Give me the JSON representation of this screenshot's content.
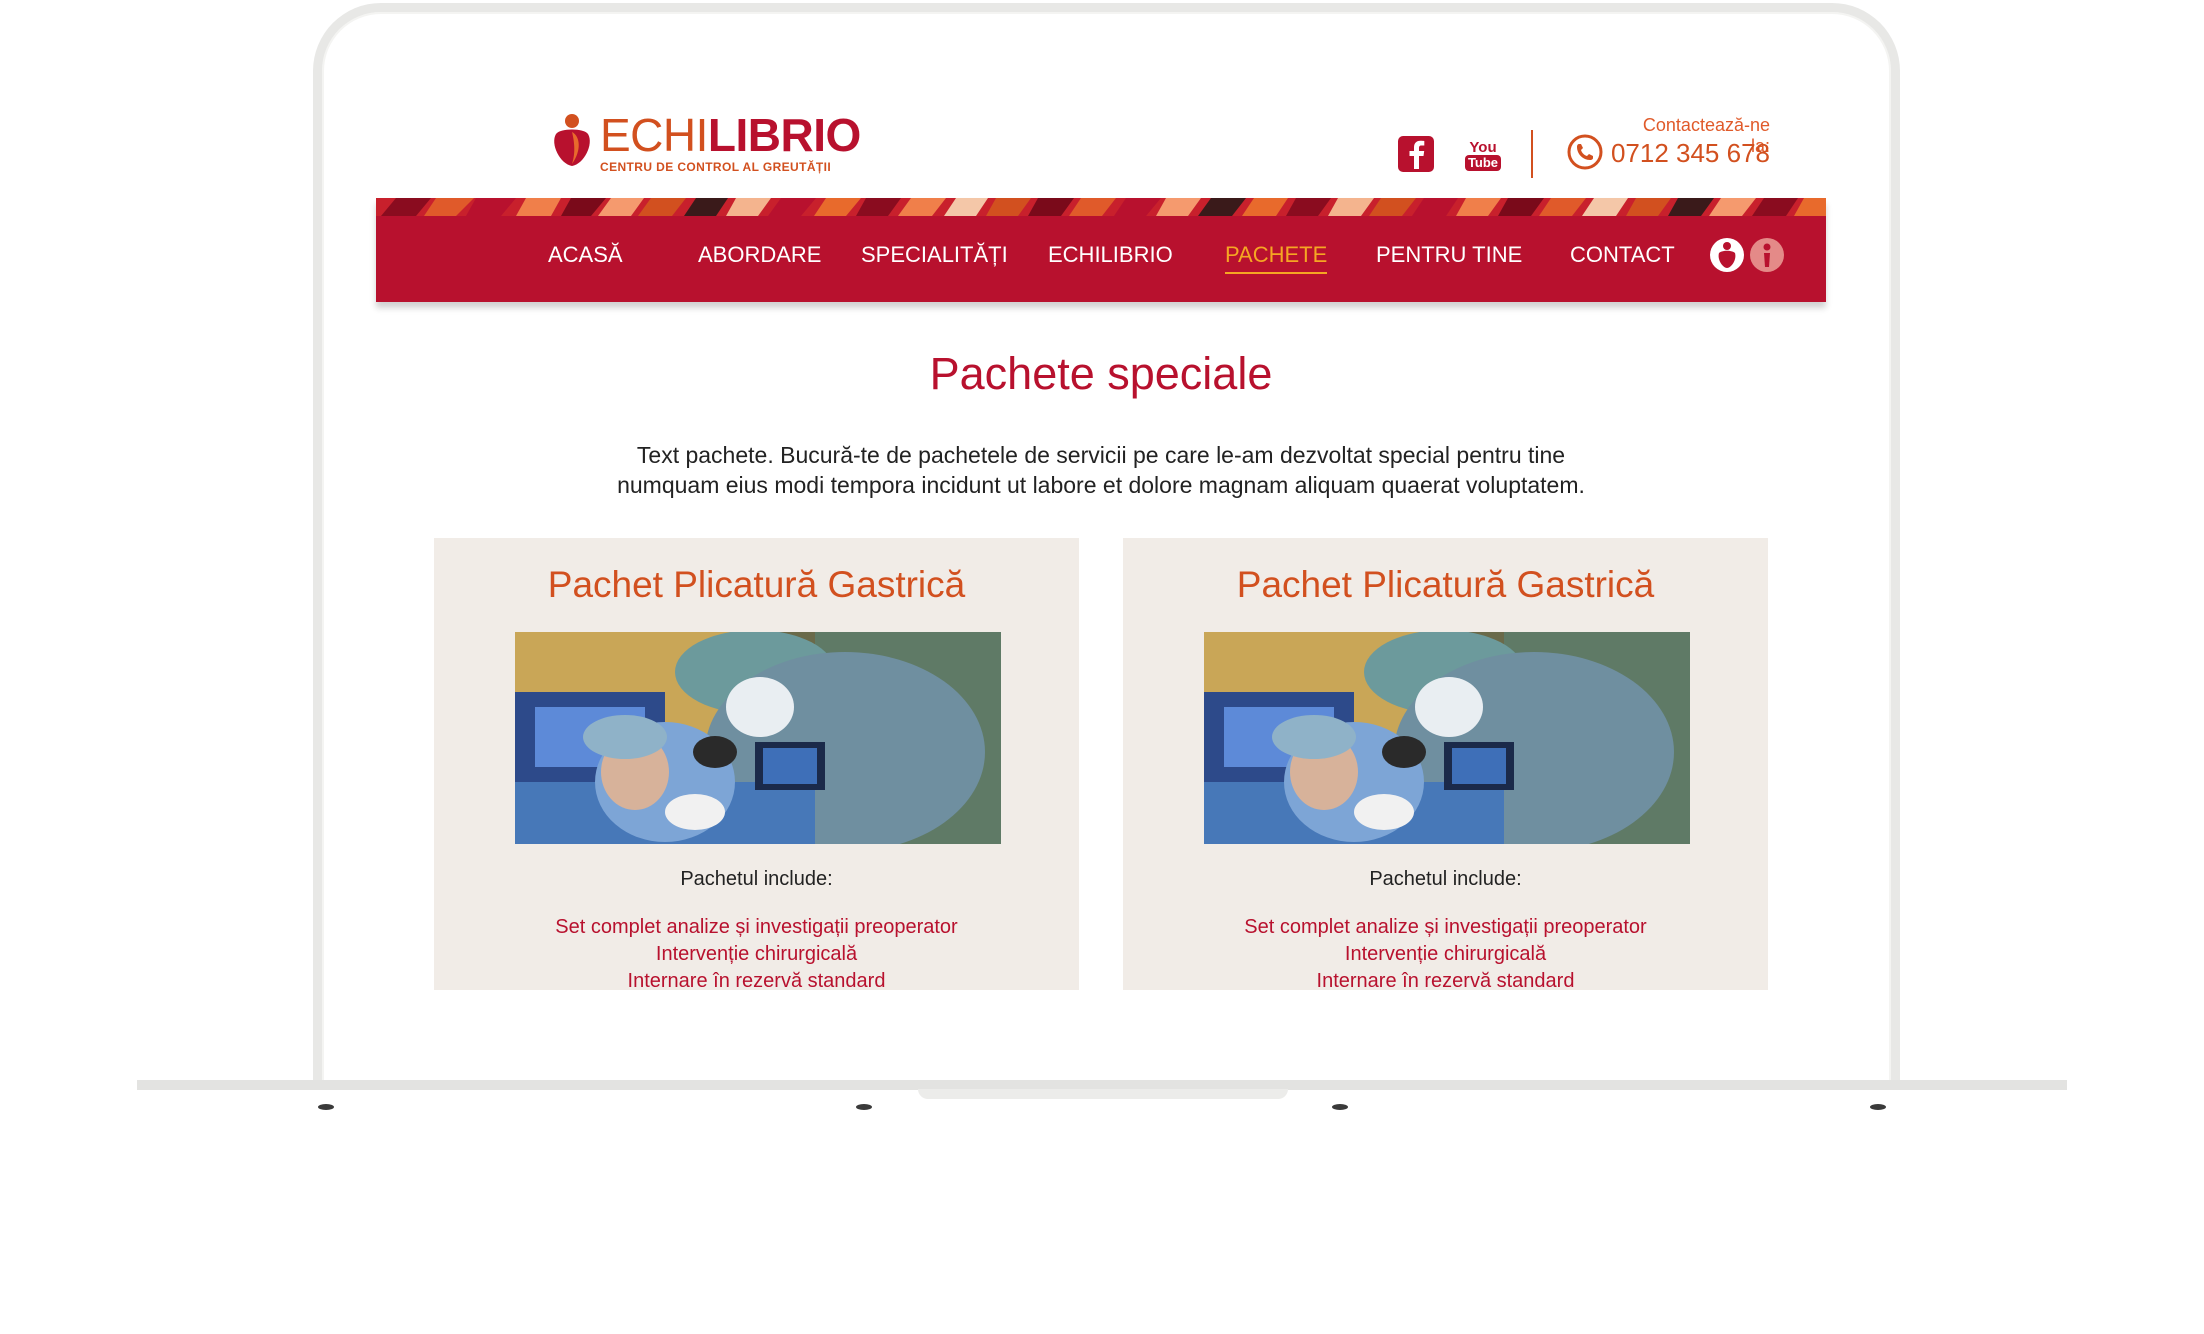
{
  "brand": {
    "name_part1": "ECHI",
    "name_part2": "LIBRIO",
    "tagline": "CENTRU DE CONTROL AL GREUTĂȚII"
  },
  "header": {
    "social": [
      {
        "icon": "facebook-icon",
        "label": "f"
      },
      {
        "icon": "youtube-icon",
        "label_top": "You",
        "label_bottom": "Tube"
      }
    ],
    "contact_label": "Contactează-ne la:",
    "contact_phone": "0712 345 678"
  },
  "nav": {
    "items": [
      {
        "label": "ACASĂ"
      },
      {
        "label": "ABORDARE"
      },
      {
        "label": "SPECIALITĂȚI"
      },
      {
        "label": "ECHILIBRIO"
      },
      {
        "label": "PACHETE",
        "active": true
      },
      {
        "label": "PENTRU TINE"
      },
      {
        "label": "CONTACT"
      }
    ],
    "icons": [
      "echilibrio-logo-icon",
      "info-icon"
    ]
  },
  "main": {
    "title": "Pachete speciale",
    "intro_line1": "Text pachete. Bucură-te de pachetele de servicii pe care le-am dezvoltat special pentru tine",
    "intro_line2": "numquam eius modi tempora incidunt ut labore et dolore magnam aliquam quaerat voluptatem.",
    "cards": [
      {
        "title": "Pachet Plicatură Gastrică",
        "includes_label": "Pachetul include:",
        "items": [
          "Set complet analize și investigații preoperator",
          "Intervenție chirurgicală",
          "Internare în rezervă standard"
        ]
      },
      {
        "title": "Pachet Plicatură Gastrică",
        "includes_label": "Pachetul include:",
        "items": [
          "Set complet analize și investigații preoperator",
          "Intervenție chirurgicală",
          "Internare în rezervă standard"
        ]
      }
    ]
  },
  "colors": {
    "brand_red": "#b8112e",
    "brand_orange": "#d2501f",
    "active_nav": "#f5a623",
    "card_bg": "#f1ece7"
  }
}
